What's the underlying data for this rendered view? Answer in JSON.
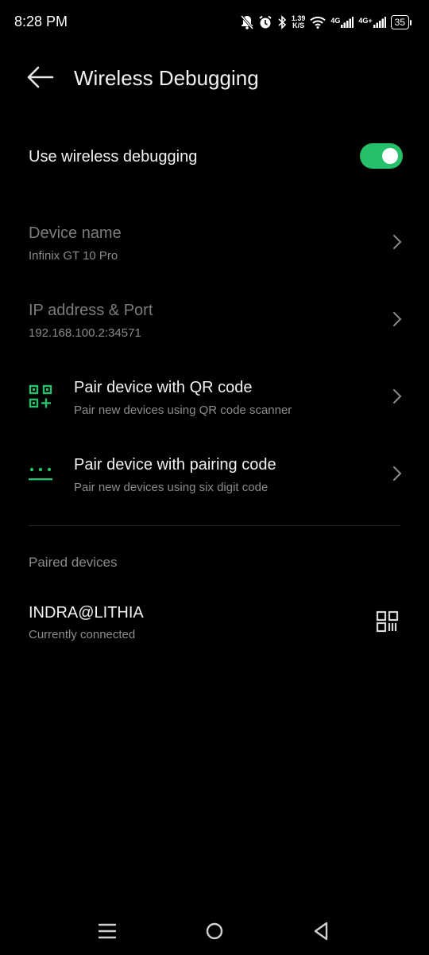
{
  "status_bar": {
    "time": "8:28 PM",
    "speed_value": "1.39",
    "speed_unit": "K/S",
    "network1": "4G",
    "network2": "4G+",
    "battery": "35",
    "icons": [
      "bell-off-icon",
      "alarm-icon",
      "bluetooth-icon",
      "wifi-icon",
      "signal-icon",
      "signal-icon",
      "battery-icon"
    ]
  },
  "header": {
    "title": "Wireless Debugging",
    "back_icon": "back-arrow-icon"
  },
  "toggle": {
    "label": "Use wireless debugging",
    "on": true,
    "color": "#27c06a"
  },
  "items": [
    {
      "title": "Device name",
      "subtitle": "Infinix GT 10 Pro"
    },
    {
      "title": "IP address & Port",
      "subtitle": "192.168.100.2:34571"
    },
    {
      "title": "Pair device with QR code",
      "subtitle": "Pair new devices using QR code scanner",
      "icon": "qr-add-icon"
    },
    {
      "title": "Pair device with pairing code",
      "subtitle": "Pair new devices using six digit code",
      "icon": "pairing-code-icon"
    }
  ],
  "paired_section": {
    "header": "Paired devices",
    "devices": [
      {
        "name": "INDRA@LITHIA",
        "status": "Currently connected",
        "icon": "qr-code-icon"
      }
    ]
  },
  "nav": {
    "icons": [
      "menu-icon",
      "home-icon",
      "back-triangle-icon"
    ]
  },
  "accent_color": "#27c06a"
}
